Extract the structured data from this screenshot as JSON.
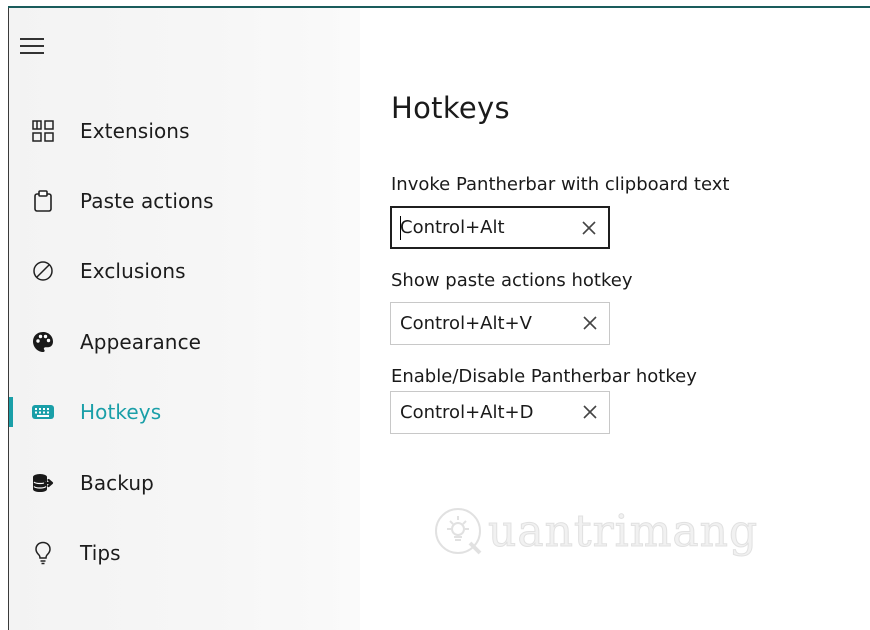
{
  "sidebar": {
    "menu_icon": "hamburger-menu-icon",
    "items": [
      {
        "label": "Extensions",
        "icon": "extensions-grid-icon",
        "active": false
      },
      {
        "label": "Paste actions",
        "icon": "clipboard-icon",
        "active": false
      },
      {
        "label": "Exclusions",
        "icon": "no-entry-icon",
        "active": false
      },
      {
        "label": "Appearance",
        "icon": "palette-icon",
        "active": false
      },
      {
        "label": "Hotkeys",
        "icon": "keyboard-icon",
        "active": true
      },
      {
        "label": "Backup",
        "icon": "database-export-icon",
        "active": false
      },
      {
        "label": "Tips",
        "icon": "lightbulb-icon",
        "active": false
      }
    ]
  },
  "main": {
    "title": "Hotkeys",
    "hotkeys": [
      {
        "label": "Invoke Pantherbar with clipboard text",
        "value": "Control+Alt",
        "focused": true
      },
      {
        "label": "Show paste actions hotkey",
        "value": "Control+Alt+V",
        "focused": false
      },
      {
        "label": "Enable/Disable Pantherbar hotkey",
        "value": "Control+Alt+D",
        "focused": false
      }
    ]
  },
  "watermark": {
    "text": "uantrimang",
    "icon": "quantrimang-logo-icon"
  },
  "colors": {
    "accent": "#1a9fa8",
    "text": "#1a1a1a",
    "sidebar_bg": "#f3f3f3",
    "border": "#c8c8c8"
  }
}
